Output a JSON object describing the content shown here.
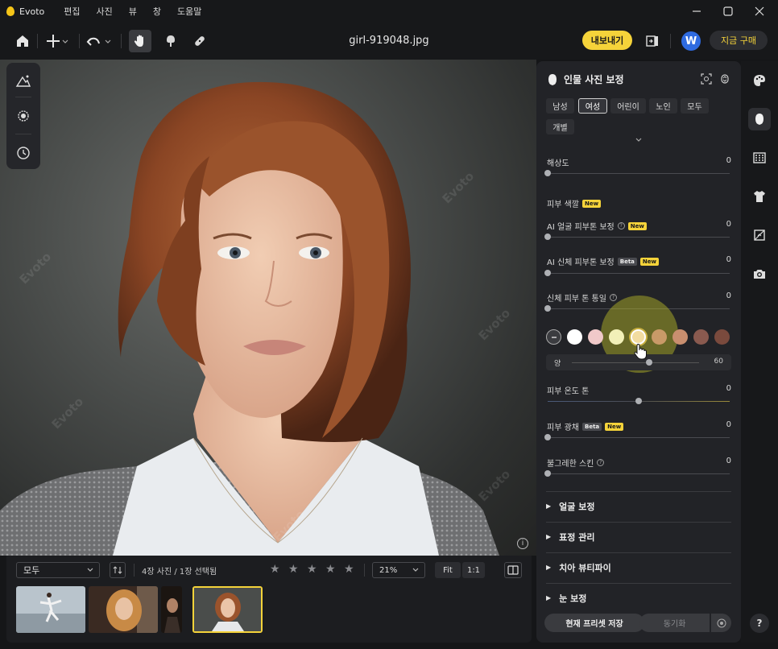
{
  "app": {
    "name": "Evoto",
    "menu": [
      "편집",
      "사진",
      "뷰",
      "창",
      "도움말"
    ]
  },
  "toolbar": {
    "file_name": "girl-919048.jpg",
    "export_label": "내보내기",
    "account_initial": "W",
    "buy_label": "지금 구매",
    "icons": [
      "home-icon",
      "add-icon",
      "undo-icon",
      "hand-icon",
      "brush-icon",
      "bandage-icon",
      "compare-icon"
    ]
  },
  "canvas": {
    "watermark": "Evoto"
  },
  "left_tools": [
    "landscape-icon",
    "settings-gear-icon",
    "history-icon"
  ],
  "filmstrip": {
    "filter_value": "모두",
    "count_text": "4장 사진 / 1장 선택됨",
    "rating_stars": 5,
    "zoom_value": "21%",
    "fit_label": "Fit",
    "one_to_one_label": "1:1",
    "thumbnails": [
      "ballet-dancer",
      "curly-hair-woman",
      "dark-portrait",
      "girl-919048"
    ],
    "selected_index": 3
  },
  "panel": {
    "title": "인물 사진 보정",
    "presets": [
      "남성",
      "여성",
      "어린이",
      "노인",
      "모두",
      "개별"
    ],
    "active_preset": "여성",
    "sliders": {
      "resolution": {
        "label": "해상도",
        "value": "0"
      },
      "skin_color_heading": "피부 색깔",
      "ai_face_tone": {
        "label": "AI 얼굴 피부톤 보정",
        "value": "0"
      },
      "ai_body_tone": {
        "label": "AI 신체 피부톤 보정",
        "value": "0"
      },
      "body_tone_unify": {
        "label": "신체 피부 톤 통일",
        "value": "0"
      },
      "amount": {
        "label": "양",
        "value": "60"
      },
      "temperature": {
        "label": "피부 온도 톤",
        "value": "0"
      },
      "gloss": {
        "label": "피부 광채",
        "value": "0"
      },
      "blush": {
        "label": "불그레한 스킨",
        "value": "0"
      }
    },
    "new_badge": "New",
    "beta_badge": "Beta",
    "swatch_colors": [
      "#ffffff",
      "#f0c9c9",
      "#f2f0b8",
      "#f2dca0",
      "#c99a68",
      "#c98f6f",
      "#8a5a4f",
      "#7a4a3d"
    ],
    "selected_swatch": 3,
    "sections": [
      "얼굴 보정",
      "표정 관리",
      "치아 뷰티파이",
      "눈 보정"
    ],
    "save_preset_label": "현재 프리셋 저장",
    "sync_label": "동기화"
  },
  "rail": {
    "items": [
      "palette-icon",
      "face-icon",
      "background-icon",
      "clothes-icon",
      "crop-icon",
      "camera-icon"
    ],
    "active": "face-icon",
    "help": "?"
  },
  "colors": {
    "accent": "#f5d33a",
    "panel_bg": "#222327",
    "app_bg": "#17181a",
    "account": "#2f6be0"
  }
}
